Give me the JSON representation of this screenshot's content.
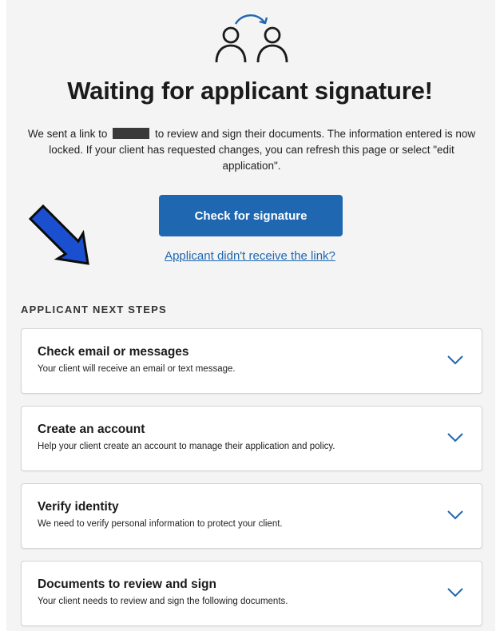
{
  "header": {
    "title": "Waiting for applicant signature!",
    "message_before": "We sent a link to",
    "message_after": "to review and sign their documents. The information entered is now locked. If your client has requested changes, you can refresh this page or select \"edit application\"."
  },
  "actions": {
    "check_button": "Check for signature",
    "link": "Applicant didn't receive the link?"
  },
  "next_steps": {
    "heading": "APPLICANT NEXT STEPS",
    "items": [
      {
        "title": "Check email or messages",
        "description": "Your client will receive an email or text message."
      },
      {
        "title": "Create an account",
        "description": "Help your client create an account to manage their application and policy."
      },
      {
        "title": "Verify identity",
        "description": "We need to verify personal information to protect your client."
      },
      {
        "title": "Documents to review and sign",
        "description": "Your client needs to review and sign the following documents."
      }
    ]
  },
  "colors": {
    "primary": "#1f67b1",
    "annotation_arrow": "#1a4fd0"
  },
  "icons": {
    "hero": "people-transfer-icon",
    "annotation": "arrow-annotation-icon",
    "card": "chevron-down-icon"
  }
}
